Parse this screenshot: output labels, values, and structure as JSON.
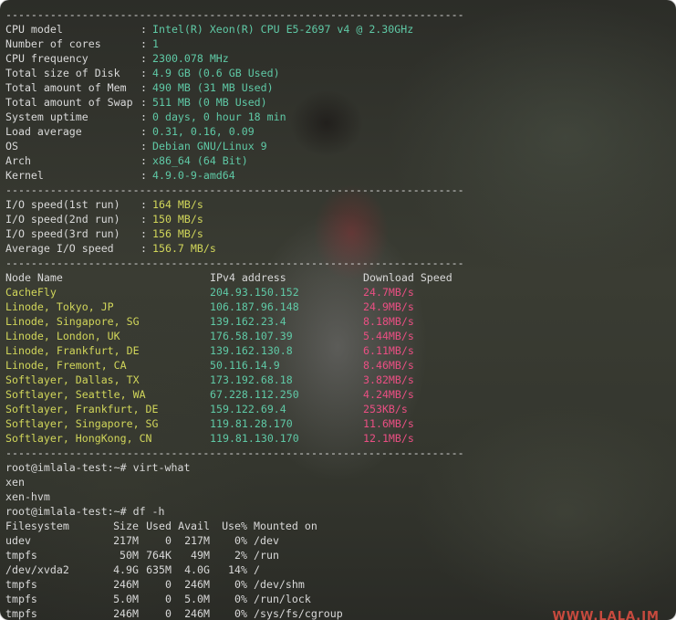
{
  "separator": "------------------------------------------------------------------------",
  "sysinfo": [
    {
      "label": "CPU model",
      "value": "Intel(R) Xeon(R) CPU E5-2697 v4 @ 2.30GHz"
    },
    {
      "label": "Number of cores",
      "value": "1"
    },
    {
      "label": "CPU frequency",
      "value": "2300.078 MHz"
    },
    {
      "label": "Total size of Disk",
      "value": "4.9 GB (0.6 GB Used)"
    },
    {
      "label": "Total amount of Mem",
      "value": "490 MB (31 MB Used)"
    },
    {
      "label": "Total amount of Swap",
      "value": "511 MB (0 MB Used)"
    },
    {
      "label": "System uptime",
      "value": "0 days, 0 hour 18 min"
    },
    {
      "label": "Load average",
      "value": "0.31, 0.16, 0.09"
    },
    {
      "label": "OS",
      "value": "Debian GNU/Linux 9"
    },
    {
      "label": "Arch",
      "value": "x86_64 (64 Bit)"
    },
    {
      "label": "Kernel",
      "value": "4.9.0-9-amd64"
    }
  ],
  "io": [
    {
      "label": "I/O speed(1st run)",
      "value": "164 MB/s"
    },
    {
      "label": "I/O speed(2nd run)",
      "value": "150 MB/s"
    },
    {
      "label": "I/O speed(3rd run)",
      "value": "156 MB/s"
    },
    {
      "label": "Average I/O speed",
      "value": "156.7 MB/s"
    }
  ],
  "speedtest": {
    "headers": [
      "Node Name",
      "IPv4 address",
      "Download Speed"
    ],
    "rows": [
      [
        "CacheFly",
        "204.93.150.152",
        "24.7MB/s"
      ],
      [
        "Linode, Tokyo, JP",
        "106.187.96.148",
        "24.9MB/s"
      ],
      [
        "Linode, Singapore, SG",
        "139.162.23.4",
        "8.18MB/s"
      ],
      [
        "Linode, London, UK",
        "176.58.107.39",
        "5.44MB/s"
      ],
      [
        "Linode, Frankfurt, DE",
        "139.162.130.8",
        "6.11MB/s"
      ],
      [
        "Linode, Fremont, CA",
        "50.116.14.9",
        "8.46MB/s"
      ],
      [
        "Softlayer, Dallas, TX",
        "173.192.68.18",
        "3.82MB/s"
      ],
      [
        "Softlayer, Seattle, WA",
        "67.228.112.250",
        "4.24MB/s"
      ],
      [
        "Softlayer, Frankfurt, DE",
        "159.122.69.4",
        "253KB/s"
      ],
      [
        "Softlayer, Singapore, SG",
        "119.81.28.170",
        "11.6MB/s"
      ],
      [
        "Softlayer, HongKong, CN",
        "119.81.130.170",
        "12.1MB/s"
      ]
    ]
  },
  "shell": [
    "root@imlala-test:~# virt-what",
    "xen",
    "xen-hvm",
    "root@imlala-test:~# df -h"
  ],
  "df": {
    "headers": [
      "Filesystem",
      "Size",
      "Used",
      "Avail",
      "Use%",
      "Mounted on"
    ],
    "rows": [
      [
        "udev",
        "217M",
        "0",
        "217M",
        "0%",
        "/dev"
      ],
      [
        "tmpfs",
        "50M",
        "764K",
        "49M",
        "2%",
        "/run"
      ],
      [
        "/dev/xvda2",
        "4.9G",
        "635M",
        "4.0G",
        "14%",
        "/"
      ],
      [
        "tmpfs",
        "246M",
        "0",
        "246M",
        "0%",
        "/dev/shm"
      ],
      [
        "tmpfs",
        "5.0M",
        "0",
        "5.0M",
        "0%",
        "/run/lock"
      ],
      [
        "tmpfs",
        "246M",
        "0",
        "246M",
        "0%",
        "/sys/fs/cgroup"
      ]
    ]
  },
  "colors": {
    "text": "#d9d9d9",
    "value": "#5fc9a6",
    "node": "#d1d65a",
    "speed": "#ea4f83"
  }
}
